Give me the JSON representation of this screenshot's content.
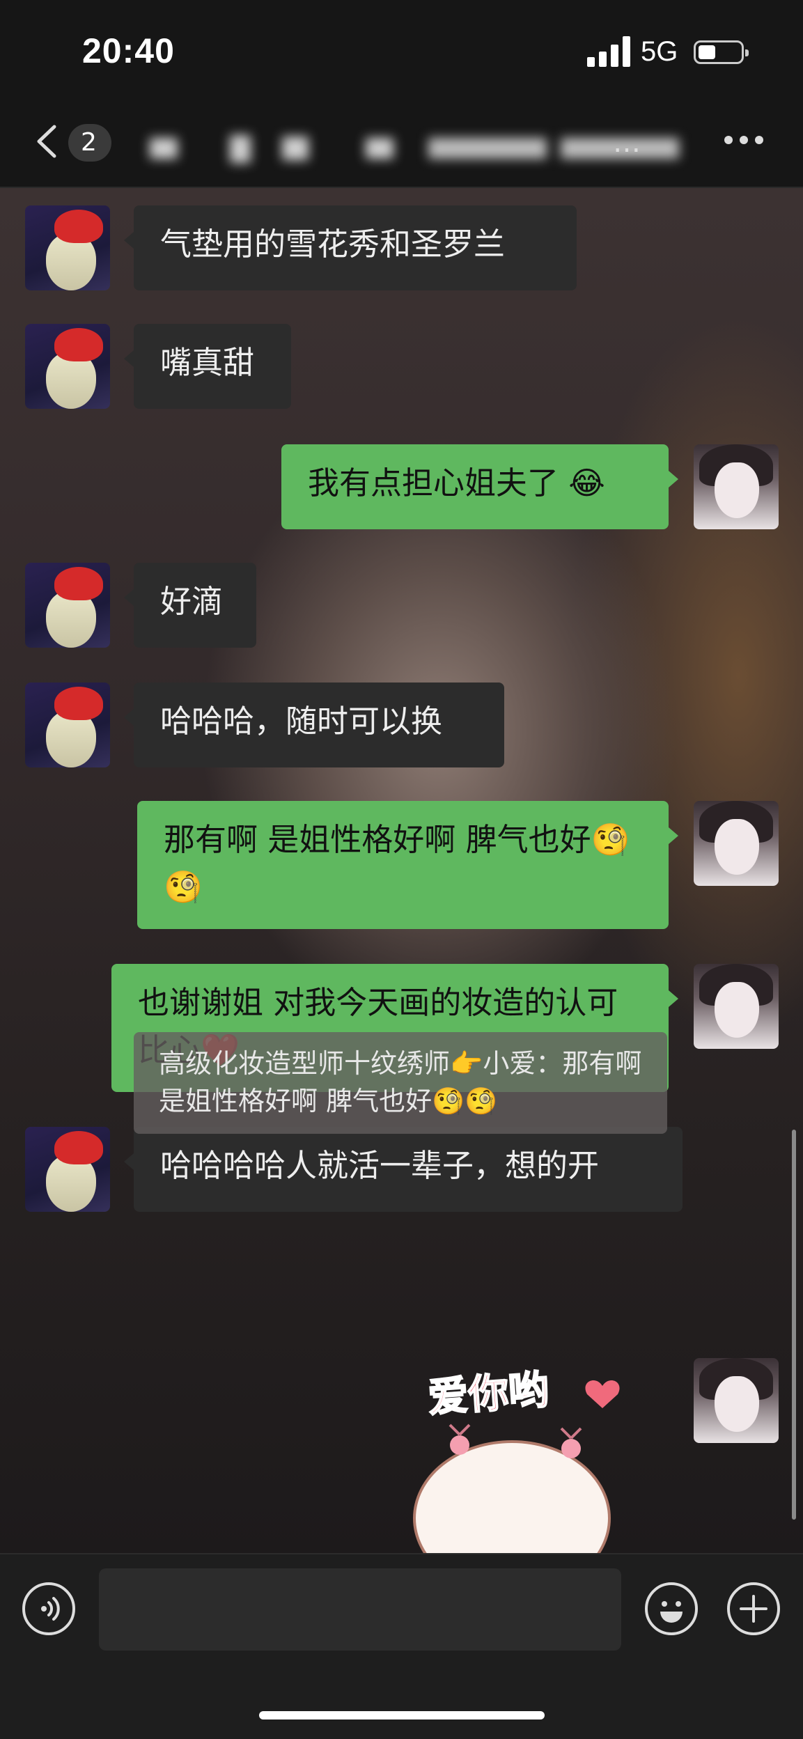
{
  "status": {
    "time": "20:40",
    "network": "5G"
  },
  "nav": {
    "unread_count": "2",
    "title": "…"
  },
  "messages": [
    {
      "side": "in",
      "text": "气垫用的雪花秀和圣罗兰"
    },
    {
      "side": "in",
      "text": "嘴真甜"
    },
    {
      "side": "out",
      "text": "我有点担心姐夫了 😂"
    },
    {
      "side": "in",
      "text": "好滴"
    },
    {
      "side": "in",
      "text": "哈哈哈，随时可以换"
    },
    {
      "side": "out",
      "text": "那有啊 是姐性格好啊 脾气也好🧐🧐"
    },
    {
      "side": "out",
      "text": "也谢谢姐 对我今天画的妆造的认可比心❤️"
    },
    {
      "side": "in",
      "text": "哈哈哈哈人就活一辈子，想的开"
    }
  ],
  "quote": {
    "text": "高级化妆造型师十纹绣师👉小爱：那有啊 是姐性格好啊 脾气也好🧐🧐"
  },
  "sticker": {
    "text": "爱你哟"
  },
  "icons": {
    "back": "chevron-left-icon",
    "more": "more-icon",
    "voice": "voice-icon",
    "emoji": "emoji-icon",
    "plus": "plus-icon"
  },
  "colors": {
    "outgoing_bubble": "#5fb85f",
    "incoming_bubble": "#2c2c2c",
    "sticker_text": "#e8485c"
  }
}
